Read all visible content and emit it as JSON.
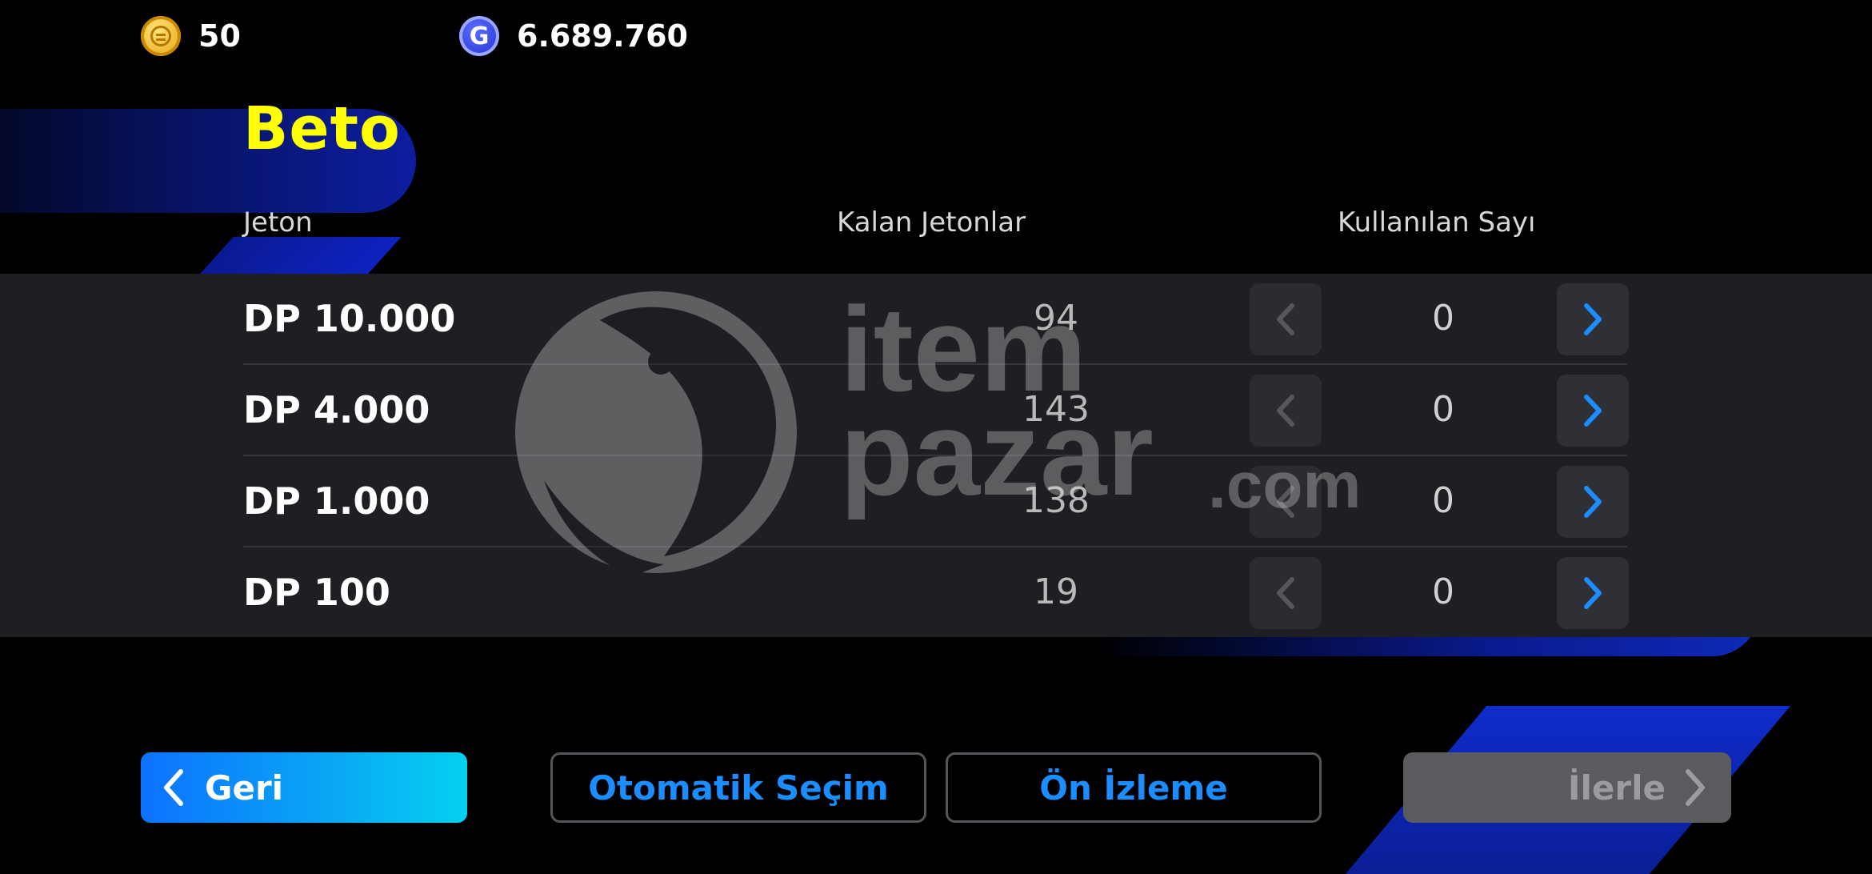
{
  "header": {
    "coins": {
      "icon": "gold-coin-icon",
      "value": "50"
    },
    "gp": {
      "icon": "gp-coin-icon",
      "icon_letter": "G",
      "value": "6.689.760"
    }
  },
  "player": {
    "name": "Beto"
  },
  "table": {
    "columns": [
      "Jeton",
      "Kalan Jetonlar",
      "Kullanılan Sayı"
    ],
    "rows": [
      {
        "name": "DP 10.000",
        "remaining": "94",
        "used": "0"
      },
      {
        "name": "DP 4.000",
        "remaining": "143",
        "used": "0"
      },
      {
        "name": "DP 1.000",
        "remaining": "138",
        "used": "0"
      },
      {
        "name": "DP 100",
        "remaining": "19",
        "used": "0"
      }
    ]
  },
  "watermark": {
    "line1": "item",
    "line2": "pazar",
    "line3": ".com"
  },
  "footer": {
    "back_label": "Geri",
    "auto_label": "Otomatik Seçim",
    "preview_label": "Ön İzleme",
    "next_label": "İlerle"
  },
  "colors": {
    "accent_blue": "#1b8dff",
    "player_name": "#ffff00",
    "panel": "#1e1f22",
    "disabled_button": "#5a5b5f"
  }
}
